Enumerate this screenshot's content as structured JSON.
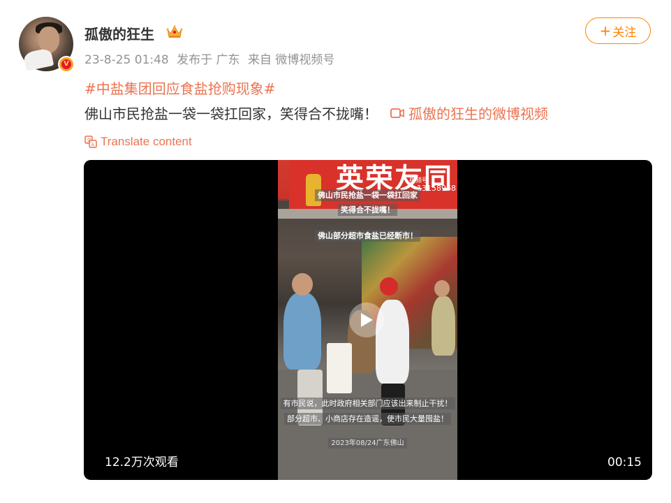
{
  "author": {
    "name": "孤傲的狂生",
    "badge_icon": "crown-icon",
    "verified_icon": "verified-v-icon",
    "verified_letter": "V"
  },
  "meta": {
    "timestamp": "23-8-25 01:48",
    "location": "发布于 广东",
    "source": "来自 微博视频号"
  },
  "follow_button": {
    "label": "关注",
    "icon": "plus-icon"
  },
  "post": {
    "topic": "#中盐集团回应食盐抢购现象#",
    "text": "佛山市民抢盐一袋一袋扛回家，笑得合不拢嘴！",
    "video_link": "孤傲的狂生的微博视频",
    "translate": "Translate content"
  },
  "video": {
    "views": "12.2万次观看",
    "duration": "00:15",
    "frame_captions": {
      "line1": "佛山市民抢盐一袋一袋扛回家",
      "line2": "笑得合不拢嘴！",
      "line3": "佛山部分超市食盐已经断市！",
      "line4": "有市民说，此时政府相关部门应该出来制止干扰！",
      "line5": "部分超市、小商店存在造谣，使市民大量囤盐！",
      "line6": "2023年08/24广东佛山"
    },
    "sign_text": "英荣友同",
    "sign_phone": "13158968",
    "watermark": "视频号",
    "play_icon": "play-icon"
  },
  "colors": {
    "accent_orange": "#ff8200",
    "link": "#eb7350",
    "meta_gray": "#939393",
    "text": "#333333"
  }
}
